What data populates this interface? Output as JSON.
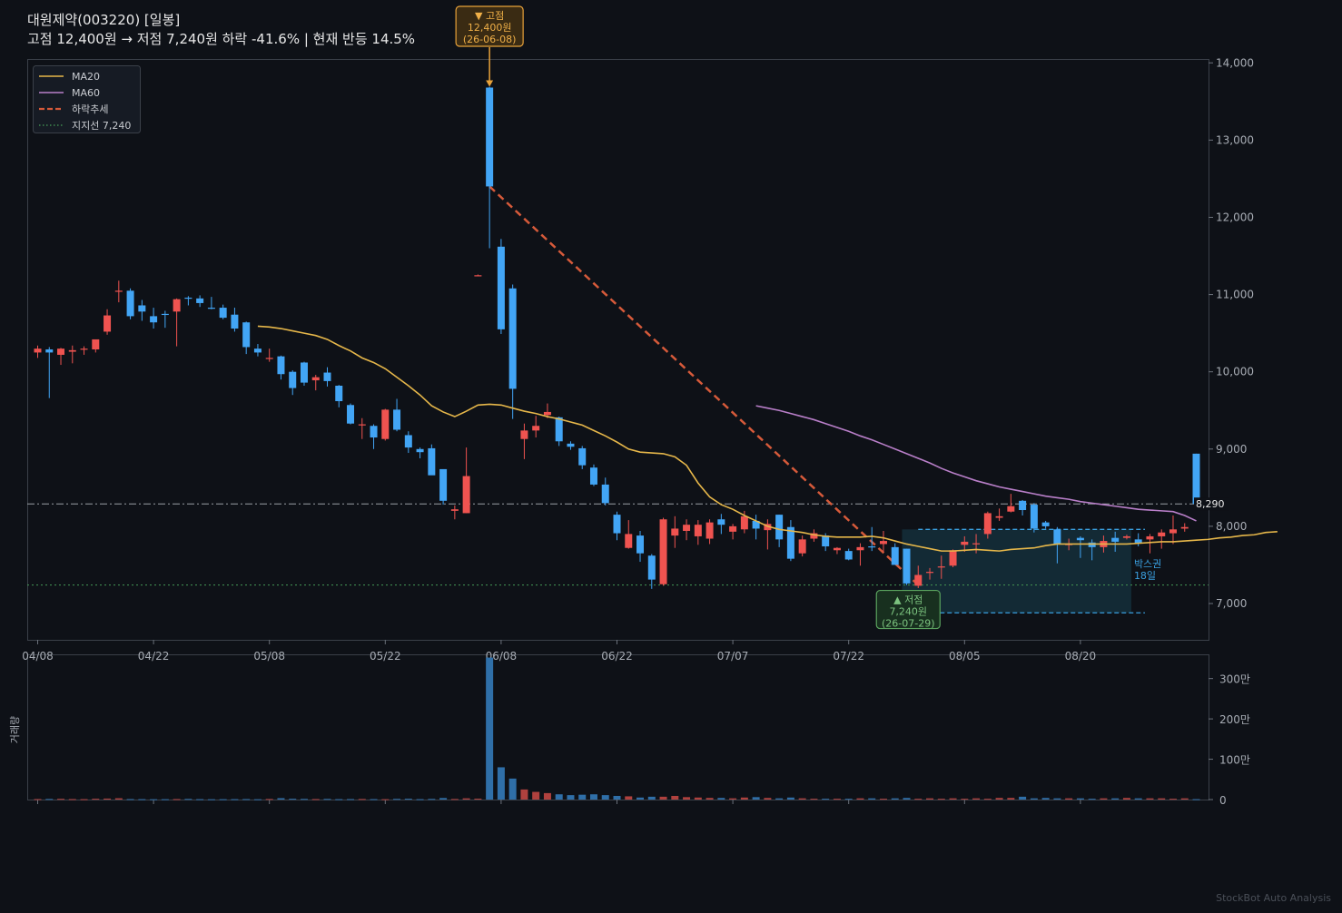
{
  "title": {
    "line1": "대원제약(003220)  [일봉]",
    "line2": "고점 12,400원 → 저점 7,240원  하락 -41.6%  |  현재 반등 14.5%"
  },
  "watermark": "StockBot Auto Analysis",
  "colors": {
    "background": "#0e1117",
    "up": "#ef5350",
    "down": "#42a5f5",
    "ma20": "#e6b74a",
    "ma60": "#b97fc9",
    "trend": "#d65a3a",
    "support": "#3f8a4f",
    "box": "#3aa0e0"
  },
  "annotations": {
    "high_label": "▼ 고점",
    "high_price": "12,400원",
    "high_date": "(26-06-08)",
    "low_label": "▲ 저점",
    "low_price": "7,240원",
    "low_date": "(26-07-29)",
    "box_label": "박스권",
    "box_days": "18일",
    "current_price_label": "8,290"
  },
  "legend": [
    {
      "label": "MA20",
      "style": "solid",
      "color": "#e6b74a"
    },
    {
      "label": "MA60",
      "style": "solid",
      "color": "#b97fc9"
    },
    {
      "label": "하락추세",
      "style": "dashed",
      "color": "#d65a3a"
    },
    {
      "label": "지지선 7,240",
      "style": "dotted",
      "color": "#3f8a4f"
    }
  ],
  "chart_data": {
    "type": "candlestick",
    "x_tick_labels": [
      "04/08",
      "04/22",
      "05/08",
      "05/22",
      "06/08",
      "06/22",
      "07/07",
      "07/22",
      "08/05",
      "08/20"
    ],
    "x_tick_index": [
      0,
      10,
      20,
      30,
      40,
      50,
      60,
      70,
      80,
      90
    ],
    "price_axis": {
      "ylim": [
        6530,
        14050
      ],
      "ticks": [
        7000,
        8000,
        9000,
        10000,
        11000,
        12000,
        13000,
        14000
      ],
      "tick_labels": [
        "7,000",
        "8,000",
        "9,000",
        "10,000",
        "11,000",
        "12,000",
        "13,000",
        "14,000"
      ]
    },
    "volume_axis": {
      "ylabel": "거래량",
      "ylim": [
        0,
        3600000
      ],
      "ticks": [
        0,
        1000000,
        2000000,
        3000000
      ],
      "tick_labels": [
        "0",
        "100만",
        "200만",
        "300만"
      ]
    },
    "reference_lines": {
      "current_price": 8290,
      "support": 7240
    },
    "trend_line": {
      "from": {
        "index": 39,
        "price": 12400
      },
      "to": {
        "index": 76,
        "price": 7240
      }
    },
    "box_range": {
      "start_index": 75,
      "end_index": 94,
      "low": 6880,
      "high": 7960
    },
    "high": {
      "index": 39,
      "price": 12400
    },
    "low": {
      "index": 76,
      "price": 7240
    },
    "candles": [
      {
        "o": 10250,
        "h": 10340,
        "l": 10180,
        "c": 10300
      },
      {
        "o": 10290,
        "h": 10320,
        "l": 9660,
        "c": 10250
      },
      {
        "o": 10220,
        "h": 10310,
        "l": 10090,
        "c": 10300
      },
      {
        "o": 10260,
        "h": 10340,
        "l": 10110,
        "c": 10280
      },
      {
        "o": 10290,
        "h": 10330,
        "l": 10220,
        "c": 10300
      },
      {
        "o": 10290,
        "h": 10380,
        "l": 10250,
        "c": 10420
      },
      {
        "o": 10520,
        "h": 10810,
        "l": 10480,
        "c": 10730
      },
      {
        "o": 11040,
        "h": 11180,
        "l": 10900,
        "c": 11050
      },
      {
        "o": 11050,
        "h": 11080,
        "l": 10680,
        "c": 10720
      },
      {
        "o": 10860,
        "h": 10930,
        "l": 10660,
        "c": 10780
      },
      {
        "o": 10720,
        "h": 10830,
        "l": 10560,
        "c": 10640
      },
      {
        "o": 10750,
        "h": 10790,
        "l": 10570,
        "c": 10740
      },
      {
        "o": 10780,
        "h": 10950,
        "l": 10330,
        "c": 10940
      },
      {
        "o": 10960,
        "h": 10980,
        "l": 10860,
        "c": 10950
      },
      {
        "o": 10950,
        "h": 10990,
        "l": 10840,
        "c": 10890
      },
      {
        "o": 10830,
        "h": 10970,
        "l": 10810,
        "c": 10820
      },
      {
        "o": 10830,
        "h": 10870,
        "l": 10680,
        "c": 10700
      },
      {
        "o": 10740,
        "h": 10830,
        "l": 10520,
        "c": 10560
      },
      {
        "o": 10640,
        "h": 10650,
        "l": 10230,
        "c": 10320
      },
      {
        "o": 10300,
        "h": 10360,
        "l": 10200,
        "c": 10250
      },
      {
        "o": 10170,
        "h": 10300,
        "l": 10130,
        "c": 10180
      },
      {
        "o": 10200,
        "h": 10210,
        "l": 9900,
        "c": 9970
      },
      {
        "o": 10000,
        "h": 10020,
        "l": 9700,
        "c": 9790
      },
      {
        "o": 10120,
        "h": 10130,
        "l": 9820,
        "c": 9860
      },
      {
        "o": 9890,
        "h": 9960,
        "l": 9760,
        "c": 9930
      },
      {
        "o": 9990,
        "h": 10060,
        "l": 9810,
        "c": 9880
      },
      {
        "o": 9820,
        "h": 9830,
        "l": 9540,
        "c": 9620
      },
      {
        "o": 9570,
        "h": 9590,
        "l": 9320,
        "c": 9330
      },
      {
        "o": 9320,
        "h": 9400,
        "l": 9130,
        "c": 9320
      },
      {
        "o": 9300,
        "h": 9320,
        "l": 9000,
        "c": 9150
      },
      {
        "o": 9130,
        "h": 9520,
        "l": 9110,
        "c": 9510
      },
      {
        "o": 9510,
        "h": 9650,
        "l": 9230,
        "c": 9250
      },
      {
        "o": 9180,
        "h": 9230,
        "l": 8950,
        "c": 9020
      },
      {
        "o": 9000,
        "h": 9020,
        "l": 8880,
        "c": 8960
      },
      {
        "o": 9010,
        "h": 9060,
        "l": 8670,
        "c": 8660
      },
      {
        "o": 8740,
        "h": 8730,
        "l": 8280,
        "c": 8330
      },
      {
        "o": 8200,
        "h": 8270,
        "l": 8090,
        "c": 8220
      },
      {
        "o": 8170,
        "h": 9020,
        "l": 8170,
        "c": 8650
      },
      {
        "o": 11250,
        "h": 11260,
        "l": 11240,
        "c": 11250
      },
      {
        "o": 13680,
        "h": 13690,
        "l": 11600,
        "c": 12400
      },
      {
        "o": 11620,
        "h": 11720,
        "l": 10490,
        "c": 10550
      },
      {
        "o": 11080,
        "h": 11130,
        "l": 9390,
        "c": 9780
      },
      {
        "o": 9130,
        "h": 9330,
        "l": 8870,
        "c": 9240
      },
      {
        "o": 9240,
        "h": 9430,
        "l": 9150,
        "c": 9300
      },
      {
        "o": 9440,
        "h": 9590,
        "l": 9400,
        "c": 9480
      },
      {
        "o": 9410,
        "h": 9420,
        "l": 9040,
        "c": 9100
      },
      {
        "o": 9070,
        "h": 9100,
        "l": 8990,
        "c": 9030
      },
      {
        "o": 9010,
        "h": 9040,
        "l": 8740,
        "c": 8790
      },
      {
        "o": 8760,
        "h": 8800,
        "l": 8520,
        "c": 8540
      },
      {
        "o": 8540,
        "h": 8630,
        "l": 8270,
        "c": 8300
      },
      {
        "o": 8150,
        "h": 8190,
        "l": 7820,
        "c": 7910
      },
      {
        "o": 7720,
        "h": 8080,
        "l": 7710,
        "c": 7900
      },
      {
        "o": 7880,
        "h": 7940,
        "l": 7540,
        "c": 7650
      },
      {
        "o": 7620,
        "h": 7640,
        "l": 7190,
        "c": 7310
      },
      {
        "o": 7250,
        "h": 8110,
        "l": 7230,
        "c": 8090
      },
      {
        "o": 7880,
        "h": 8130,
        "l": 7720,
        "c": 7970
      },
      {
        "o": 7940,
        "h": 8090,
        "l": 7820,
        "c": 8020
      },
      {
        "o": 7870,
        "h": 8080,
        "l": 7760,
        "c": 8020
      },
      {
        "o": 7840,
        "h": 8090,
        "l": 7770,
        "c": 8050
      },
      {
        "o": 8090,
        "h": 8160,
        "l": 7900,
        "c": 8020
      },
      {
        "o": 7930,
        "h": 8030,
        "l": 7830,
        "c": 8000
      },
      {
        "o": 7960,
        "h": 8200,
        "l": 7910,
        "c": 8130
      },
      {
        "o": 8070,
        "h": 8150,
        "l": 7830,
        "c": 7970
      },
      {
        "o": 7950,
        "h": 8090,
        "l": 7700,
        "c": 8030
      },
      {
        "o": 8150,
        "h": 8150,
        "l": 7730,
        "c": 7830
      },
      {
        "o": 7990,
        "h": 8080,
        "l": 7550,
        "c": 7580
      },
      {
        "o": 7650,
        "h": 7880,
        "l": 7610,
        "c": 7830
      },
      {
        "o": 7840,
        "h": 7960,
        "l": 7800,
        "c": 7910
      },
      {
        "o": 7880,
        "h": 7910,
        "l": 7680,
        "c": 7740
      },
      {
        "o": 7690,
        "h": 7730,
        "l": 7640,
        "c": 7720
      },
      {
        "o": 7680,
        "h": 7710,
        "l": 7560,
        "c": 7570
      },
      {
        "o": 7690,
        "h": 7780,
        "l": 7490,
        "c": 7730
      },
      {
        "o": 7740,
        "h": 7990,
        "l": 7680,
        "c": 7730
      },
      {
        "o": 7770,
        "h": 7940,
        "l": 7670,
        "c": 7810
      },
      {
        "o": 7730,
        "h": 7780,
        "l": 7510,
        "c": 7500
      },
      {
        "o": 7710,
        "h": 7710,
        "l": 7240,
        "c": 7260
      },
      {
        "o": 7230,
        "h": 7490,
        "l": 7200,
        "c": 7370
      },
      {
        "o": 7400,
        "h": 7460,
        "l": 7310,
        "c": 7410
      },
      {
        "o": 7480,
        "h": 7620,
        "l": 7320,
        "c": 7480
      },
      {
        "o": 7490,
        "h": 7700,
        "l": 7470,
        "c": 7690
      },
      {
        "o": 7760,
        "h": 7870,
        "l": 7670,
        "c": 7800
      },
      {
        "o": 7770,
        "h": 7900,
        "l": 7650,
        "c": 7780
      },
      {
        "o": 7900,
        "h": 8190,
        "l": 7840,
        "c": 8170
      },
      {
        "o": 8110,
        "h": 8230,
        "l": 8070,
        "c": 8130
      },
      {
        "o": 8190,
        "h": 8420,
        "l": 8180,
        "c": 8260
      },
      {
        "o": 8330,
        "h": 8340,
        "l": 8140,
        "c": 8210
      },
      {
        "o": 8280,
        "h": 8300,
        "l": 7920,
        "c": 7970
      },
      {
        "o": 8050,
        "h": 8070,
        "l": 7970,
        "c": 8000
      },
      {
        "o": 7960,
        "h": 7990,
        "l": 7520,
        "c": 7770
      },
      {
        "o": 7760,
        "h": 7840,
        "l": 7690,
        "c": 7770
      },
      {
        "o": 7850,
        "h": 7870,
        "l": 7590,
        "c": 7820
      },
      {
        "o": 7790,
        "h": 7830,
        "l": 7560,
        "c": 7730
      },
      {
        "o": 7730,
        "h": 7880,
        "l": 7660,
        "c": 7810
      },
      {
        "o": 7850,
        "h": 7930,
        "l": 7670,
        "c": 7800
      },
      {
        "o": 7850,
        "h": 7890,
        "l": 7830,
        "c": 7870
      },
      {
        "o": 7830,
        "h": 7910,
        "l": 7740,
        "c": 7780
      },
      {
        "o": 7830,
        "h": 7900,
        "l": 7650,
        "c": 7870
      },
      {
        "o": 7870,
        "h": 7960,
        "l": 7710,
        "c": 7920
      },
      {
        "o": 7910,
        "h": 8140,
        "l": 7770,
        "c": 7960
      },
      {
        "o": 7970,
        "h": 8040,
        "l": 7930,
        "c": 7990
      },
      {
        "o": 8940,
        "h": 8940,
        "l": 8210,
        "c": 8290
      }
    ],
    "ma20": [
      10590,
      10580,
      10560,
      10530,
      10500,
      10470,
      10420,
      10340,
      10270,
      10180,
      10120,
      10040,
      9930,
      9820,
      9700,
      9560,
      9480,
      9420,
      9490,
      9570,
      9580,
      9570,
      9530,
      9490,
      9460,
      9420,
      9390,
      9350,
      9310,
      9240,
      9170,
      9090,
      9000,
      8960,
      8950,
      8940,
      8900,
      8790,
      8560,
      8380,
      8280,
      8220,
      8140,
      8070,
      8000,
      7960,
      7940,
      7920,
      7890,
      7870,
      7860,
      7860,
      7860,
      7870,
      7850,
      7810,
      7770,
      7740,
      7710,
      7680,
      7680,
      7690,
      7700,
      7690,
      7680,
      7700,
      7710,
      7720,
      7750,
      7770,
      7770,
      7770,
      7770,
      7770,
      7770,
      7770,
      7780,
      7790,
      7800,
      7800,
      7810,
      7820,
      7830,
      7850,
      7860,
      7880,
      7890,
      7920,
      7930
    ],
    "ma60": [
      9560,
      9530,
      9500,
      9460,
      9420,
      9380,
      9330,
      9280,
      9230,
      9170,
      9120,
      9060,
      9000,
      8940,
      8880,
      8820,
      8750,
      8690,
      8640,
      8590,
      8550,
      8510,
      8480,
      8450,
      8420,
      8390,
      8370,
      8350,
      8320,
      8300,
      8280,
      8260,
      8240,
      8220,
      8210,
      8200,
      8190,
      8140,
      8070
    ],
    "volume": [
      12000,
      15000,
      18000,
      12000,
      10000,
      20000,
      24000,
      32000,
      12000,
      10000,
      8000,
      9000,
      12000,
      16000,
      10000,
      8000,
      9000,
      10000,
      12000,
      8000,
      14000,
      34000,
      20000,
      16000,
      12000,
      16000,
      10000,
      12000,
      14000,
      11000,
      9000,
      17000,
      21000,
      10000,
      16000,
      38000,
      14000,
      30000,
      22000,
      3520000,
      800000,
      520000,
      250000,
      190000,
      160000,
      130000,
      110000,
      120000,
      130000,
      110000,
      90000,
      80000,
      50000,
      70000,
      70000,
      90000,
      60000,
      50000,
      40000,
      40000,
      30000,
      50000,
      60000,
      40000,
      30000,
      50000,
      30000,
      20000,
      20000,
      20000,
      20000,
      30000,
      30000,
      20000,
      30000,
      40000,
      20000,
      30000,
      20000,
      30000,
      20000,
      30000,
      20000,
      40000,
      40000,
      70000,
      30000,
      40000,
      30000,
      30000,
      30000,
      20000,
      30000,
      30000,
      40000,
      30000,
      30000,
      30000,
      20000,
      30000,
      10000,
      240000
    ]
  }
}
